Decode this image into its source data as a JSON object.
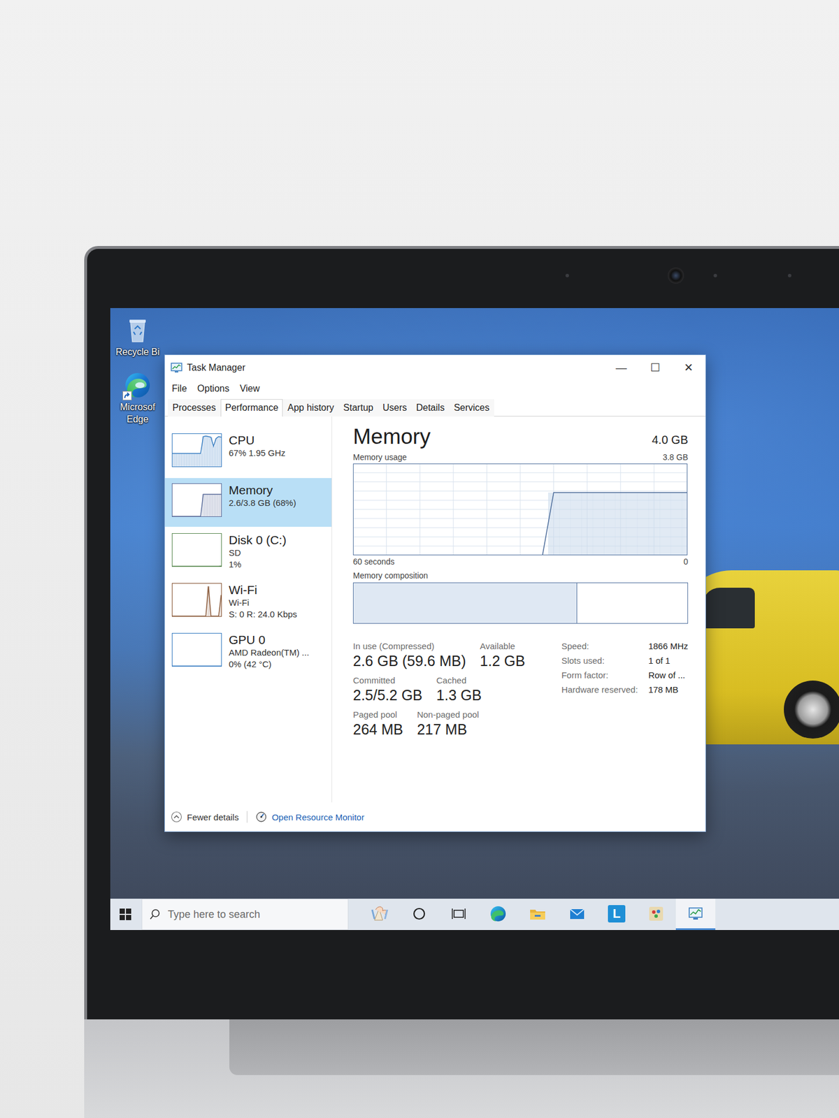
{
  "desktop": {
    "icons": [
      {
        "kind": "recycle-bin",
        "lines": [
          "Recycle Bi"
        ]
      },
      {
        "kind": "edge",
        "lines": [
          "Microsof",
          "Edge"
        ]
      }
    ]
  },
  "window": {
    "title": "Task Manager",
    "controls": [
      "—",
      "☐",
      "✕"
    ]
  },
  "menu": [
    "File",
    "Options",
    "View"
  ],
  "tabs": [
    {
      "label": "Processes",
      "selected": false
    },
    {
      "label": "Performance",
      "selected": true
    },
    {
      "label": "App history",
      "selected": false
    },
    {
      "label": "Startup",
      "selected": false
    },
    {
      "label": "Users",
      "selected": false
    },
    {
      "label": "Details",
      "selected": false
    },
    {
      "label": "Services",
      "selected": false
    }
  ],
  "sidebar": {
    "items": [
      {
        "name": "CPU",
        "lines": [
          "67% 1.95 GHz"
        ],
        "selected": false,
        "color": "#3b7fc2",
        "graph": [
          40,
          40,
          40,
          40,
          40,
          40,
          40,
          40,
          40,
          40,
          40,
          40,
          92,
          94,
          92,
          90,
          62,
          86,
          92,
          90
        ]
      },
      {
        "name": "Memory",
        "lines": [
          "2.6/3.8 GB (68%)"
        ],
        "selected": true,
        "color": "#5d6f9c",
        "graph": [
          0,
          0,
          0,
          0,
          0,
          0,
          0,
          0,
          0,
          0,
          0,
          0,
          68,
          68,
          68,
          68,
          68,
          68,
          68,
          68
        ]
      },
      {
        "name": "Disk 0 (C:)",
        "lines": [
          "SD",
          "1%"
        ],
        "selected": false,
        "color": "#5e8c55",
        "graph": [
          0,
          0,
          0,
          0,
          0,
          0,
          0,
          0,
          0,
          0,
          0,
          0,
          0,
          0,
          0,
          0,
          0,
          0,
          0,
          1
        ]
      },
      {
        "name": "Wi-Fi",
        "lines": [
          "Wi-Fi",
          "S: 0 R: 24.0 Kbps"
        ],
        "selected": false,
        "color": "#8a5a3a",
        "graph": [
          0,
          0,
          0,
          0,
          0,
          0,
          0,
          0,
          0,
          0,
          0,
          0,
          0,
          0,
          92,
          0,
          0,
          0,
          0,
          65
        ]
      },
      {
        "name": "GPU 0",
        "lines": [
          "AMD Radeon(TM) ...",
          "0% (42 °C)"
        ],
        "selected": false,
        "color": "#3b7fc2",
        "graph": [
          0,
          0,
          0,
          0,
          0,
          0,
          0,
          0,
          0,
          0,
          0,
          0,
          0,
          0,
          0,
          0,
          0,
          0,
          0,
          0
        ]
      }
    ]
  },
  "memory": {
    "title": "Memory",
    "total": "4.0 GB",
    "usage_label": "Memory usage",
    "usage_max": "3.8 GB",
    "chart": {
      "series": [
        {
          "values": [
            0,
            0,
            0,
            0,
            0,
            0,
            0,
            0,
            0,
            0,
            0,
            0,
            0,
            0,
            0,
            0,
            0,
            0,
            2.6,
            2.6,
            2.6,
            2.6,
            2.6,
            2.6,
            2.6,
            2.6,
            2.6,
            2.6,
            2.6,
            2.6,
            2.6
          ]
        }
      ],
      "x_start": "60 seconds",
      "x_end": "0"
    },
    "composition": {
      "label": "Memory composition",
      "level": 0.67
    },
    "stats": [
      [
        {
          "label": "In use (Compressed)",
          "value": "2.6 GB (59.6 MB)"
        },
        {
          "label": "Available",
          "value": "1.2 GB"
        }
      ],
      [
        {
          "label": "Committed",
          "value": "2.5/5.2 GB"
        },
        {
          "label": "Cached",
          "value": "1.3 GB"
        }
      ],
      [
        {
          "label": "Paged pool",
          "value": "264 MB"
        },
        {
          "label": "Non-paged pool",
          "value": "217 MB"
        }
      ]
    ],
    "details": [
      {
        "label": "Speed:",
        "value": "1866 MHz"
      },
      {
        "label": "Slots used:",
        "value": "1 of 1"
      },
      {
        "label": "Form factor:",
        "value": "Row of ..."
      },
      {
        "label": "Hardware reserved:",
        "value": "178 MB"
      }
    ]
  },
  "footer": {
    "toggle": "Fewer details",
    "link": "Open Resource Monitor"
  },
  "taskbar": {
    "search": {
      "placeholder": "Type here to search"
    },
    "apps": [
      {
        "kind": "search-highlight",
        "selected": false
      },
      {
        "kind": "cortana",
        "selected": false
      },
      {
        "kind": "task-view",
        "selected": false
      },
      {
        "kind": "edge",
        "selected": false
      },
      {
        "kind": "explorer",
        "selected": false
      },
      {
        "kind": "mail",
        "selected": false
      },
      {
        "kind": "letter",
        "text": "L",
        "selected": false
      },
      {
        "kind": "paint",
        "selected": false
      },
      {
        "kind": "task-manager",
        "selected": true
      }
    ]
  }
}
